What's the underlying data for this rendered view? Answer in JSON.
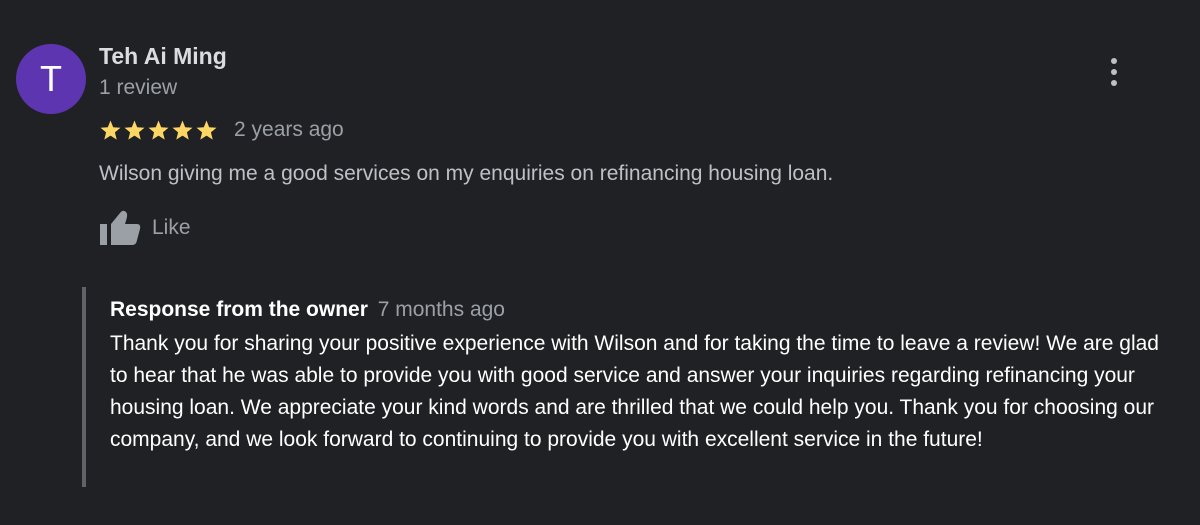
{
  "review": {
    "avatar_initial": "T",
    "avatar_color": "#5e35b1",
    "reviewer_name": "Teh Ai Ming",
    "review_count": "1 review",
    "rating": 5,
    "rating_max": 5,
    "star_color": "#fdd663",
    "date": "2 years ago",
    "text": "Wilson giving me a good services on my enquiries on refinancing housing loan.",
    "like_label": "Like",
    "like_icon": "thumbs-up-icon",
    "more_icon": "more-vertical-icon"
  },
  "owner_response": {
    "title": "Response from the owner",
    "date": "7 months ago",
    "text": "Thank you for sharing your positive experience with Wilson and for taking the time to leave a review! We are glad to hear that he was able to provide you with good service and answer your inquiries regarding refinancing your housing loan. We appreciate your kind words and are thrilled that we could help you. Thank you for choosing our company, and we look forward to continuing to provide you with excellent service in the future!"
  },
  "colors": {
    "background": "#202124",
    "primary_text": "#e8eaed",
    "secondary_text": "#9aa0a6",
    "response_border": "#5f6368"
  }
}
